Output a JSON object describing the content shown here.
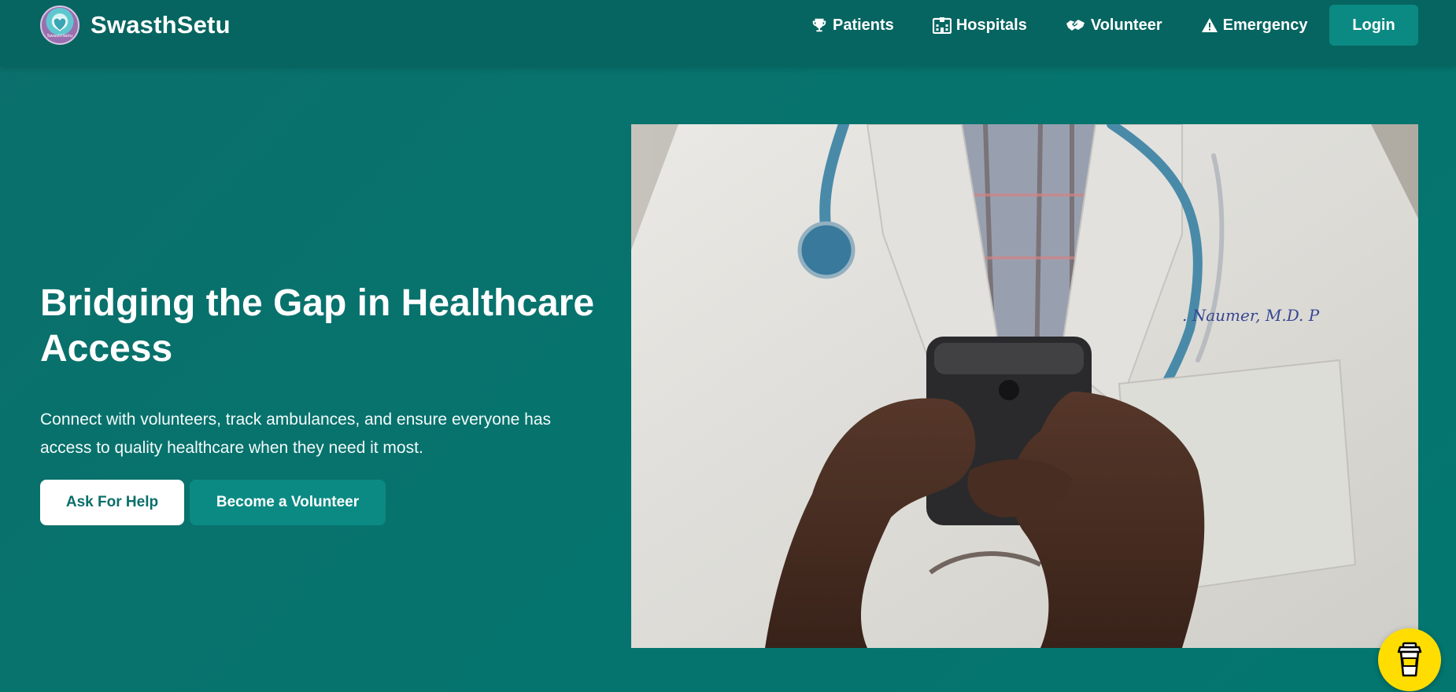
{
  "brand": {
    "name": "SwasthSetu",
    "logo_text": "SwasthSetu"
  },
  "nav": {
    "items": [
      {
        "label": "Patients",
        "icon": "trophy-icon"
      },
      {
        "label": "Hospitals",
        "icon": "hospital-icon"
      },
      {
        "label": "Volunteer",
        "icon": "handshake-icon"
      },
      {
        "label": "Emergency",
        "icon": "warning-icon"
      }
    ],
    "login_label": "Login"
  },
  "hero": {
    "title": "Bridging the Gap in Healthcare Access",
    "subtitle": "Connect with volunteers, track ambulances, and ensure everyone has access to quality healthcare when they need it most.",
    "primary_button": "Ask For Help",
    "secondary_button": "Become a Volunteer",
    "image_label": "Doctor holding a smartphone"
  },
  "widgets": {
    "coffee_icon": "coffee-cup-icon"
  },
  "colors": {
    "background": "#07736d",
    "navbar": "#066560",
    "accent_button": "#0b8a83",
    "coffee_button": "#ffdd00"
  }
}
